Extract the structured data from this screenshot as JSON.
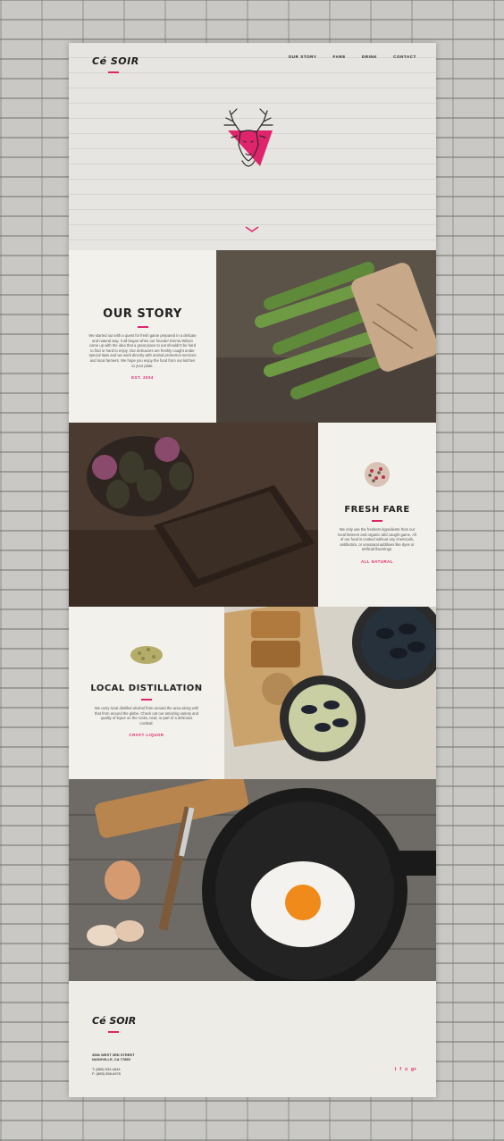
{
  "brand": {
    "logo": "Cé SOIR",
    "accent_color": "#e0246b"
  },
  "nav": {
    "items": [
      "OUR STORY",
      "FARE",
      "DRINK",
      "CONTACT"
    ]
  },
  "hero": {
    "emblem": "stag-head-icon",
    "scroll_icon": "chevron-down-icon"
  },
  "story": {
    "title": "OUR STORY",
    "body": "We started out with a quest for fresh game prepared in a delicate and natural way. It all began when our founder Emma Wilson came up with the idea that a great place to eat shouldn't be hard to find or hard to enjoy. Our delicacies are freshly caught under special laws and we work directly with animal protection services and local farmers. We hope you enjoy the food from our kitchen to your plate.",
    "tag": "EST. 2004"
  },
  "fare": {
    "title": "FRESH FARE",
    "body": "We only use the freshest ingredients from our local farmers and organic wild caught game. All of our food is cooked without any chemicals, antibiotics, or unnatural additives like dyes or artificial flavorings.",
    "tag": "ALL NATURAL"
  },
  "distill": {
    "title": "LOCAL DISTILLATION",
    "body": "We carry local distilled alcohol from around the area along with that from around the globe. Check out our amazing variety and quality of liquor on the rocks, neat, or part of a delicious cocktail.",
    "tag": "CRAFT LIQUOR"
  },
  "footer": {
    "logo": "Cé SOIR",
    "address_line1": "3566 WEST 3RD STREET",
    "address_line2": "NASHVILLE, CA 77895",
    "phone": "T: (865) 534-4644",
    "fax": "F: (865) 556-6976",
    "social": [
      "twitter-icon",
      "facebook-icon",
      "instagram-icon",
      "google-plus-icon"
    ]
  }
}
